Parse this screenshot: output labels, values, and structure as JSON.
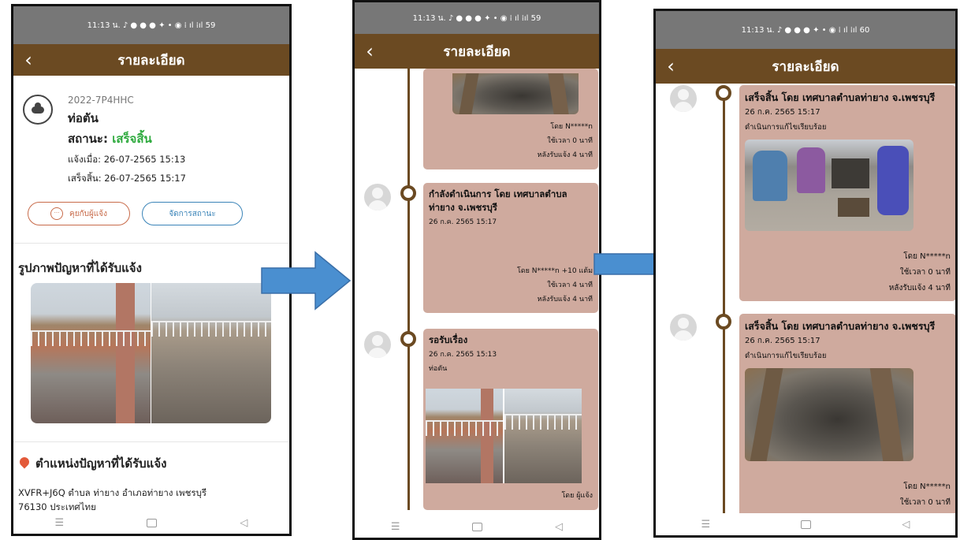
{
  "status_bar": {
    "p1": "11:13 น.  ♪ ● ● ● ✦ •    ◉ ⁞ ıl  ⁞ıl  59",
    "p2": "11:13 น.  ♪ ● ● ● ✦ •    ◉ ⁞ ıl  ⁞ıl  59",
    "p3": "11:13 น.  ♪ ● ● ● ✦ •    ◉ ⁞ ıl  ⁞ıl  60"
  },
  "appbar": {
    "back": "‹",
    "title": "รายละเอียด"
  },
  "detail": {
    "id": "2022-7P4HHC",
    "category": "ท่อตัน",
    "status_label": "สถานะ: ",
    "status_value": "เสร็จสิ้น",
    "reported": "แจ้งเมื่อ: 26-07-2565 15:13",
    "finished": "เสร็จสิ้น: 26-07-2565 15:17",
    "chat_button": "คุยกับผู้แจ้ง",
    "manage_button": "จัดการสถานะ",
    "photos_title": "รูปภาพปัญหาที่ได้รับแจ้ง",
    "location_title": "ตำแหน่งปัญหาที่ได้รับแจ้ง",
    "address_line1": "XVFR+J6Q ตำบล ท่ายาง อำเภอท่ายาง เพชรบุรี",
    "address_line2": "76130 ประเทศไทย"
  },
  "timeline_mid": {
    "top_card": {
      "by": "โดย N*****n",
      "took": "ใช้เวลา 0 นาที",
      "after": "หลังรับแจ้ง 4 นาที"
    },
    "progress_card": {
      "head": "กำลังดำเนินการ โดย  เทศบาลตำบลท่ายาง จ.เพชรบุรี",
      "date": "26 ก.ค. 2565 15:17",
      "by": "โดย N*****n +10 แต้ม",
      "took": "ใช้เวลา 4 นาที",
      "after": "หลังรับแจ้ง 4 นาที"
    },
    "waiting_card": {
      "head": "รอรับเรื่อง",
      "date": "26 ก.ค. 2565 15:13",
      "desc": "ท่อตัน",
      "by": "โดย ผู้แจ้ง"
    }
  },
  "timeline_right": {
    "card1": {
      "head": "เสร็จสิ้น โดย  เทศบาลตำบลท่ายาง จ.เพชรบุรี",
      "date": "26 ก.ค. 2565 15:17",
      "desc": "ดำเนินการแก้ไขเรียบร้อย",
      "by": "โดย N*****n",
      "took": "ใช้เวลา 0 นาที",
      "after": "หลังรับแจ้ง 4 นาที"
    },
    "card2": {
      "head": "เสร็จสิ้น โดย  เทศบาลตำบลท่ายาง จ.เพชรบุรี",
      "date": "26 ก.ค. 2565 15:17",
      "desc": "ดำเนินการแก้ไขเรียบร้อย",
      "by": "โดย N*****n",
      "took": "ใช้เวลา 0 นาที"
    }
  },
  "navbar": {
    "menu": "☰",
    "back": "◁"
  },
  "colors": {
    "appbar": "#6b4a22",
    "status_done": "#2eaa3e",
    "card": "#cfaa9e",
    "arrow": "#4a8fd0"
  }
}
